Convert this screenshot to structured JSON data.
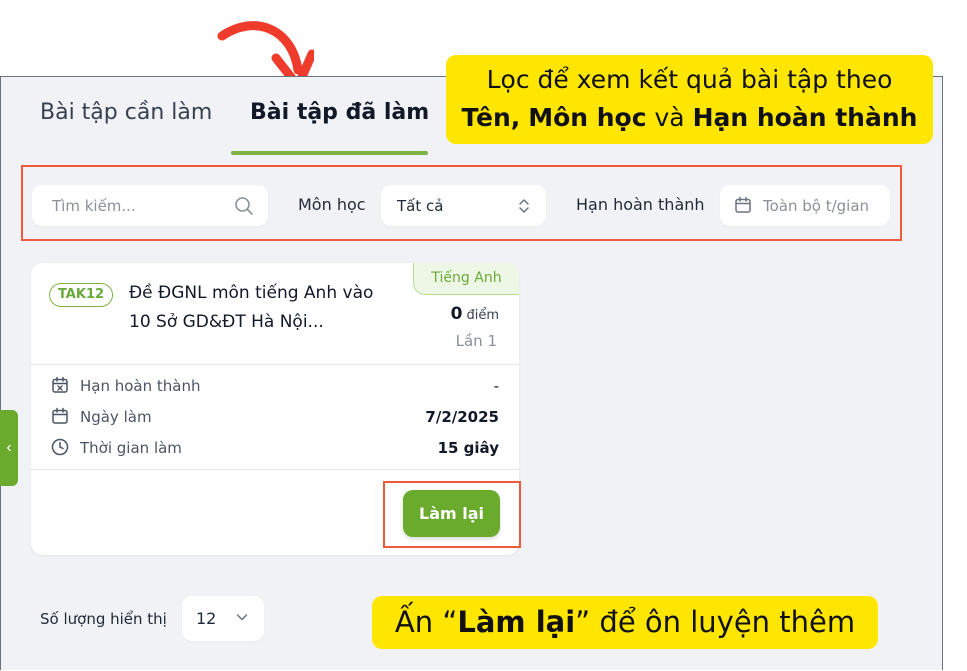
{
  "tabs": {
    "todo": "Bài tập cần làm",
    "done": "Bài tập đã làm"
  },
  "callout_top": {
    "line1": "Lọc để xem kết quả bài tập theo",
    "name": "Tên,",
    "subject": "Môn học",
    "and": "và",
    "deadline": "Hạn hoàn thành"
  },
  "callout_bottom": {
    "prefix": "Ấn “",
    "action": "Làm lại",
    "suffix": "” để ôn luyện thêm"
  },
  "filters": {
    "search_placeholder": "Tìm kiếm...",
    "subject_label": "Môn học",
    "subject_value": "Tất cả",
    "deadline_label": "Hạn hoàn thành",
    "deadline_placeholder": "Toàn bộ t/gian"
  },
  "card": {
    "subject_tag": "Tiếng Anh",
    "code": "TAK12",
    "title": "Đề ĐGNL môn tiếng Anh vào 10 Sở GD&ĐT Hà Nội...",
    "score": "0",
    "score_unit": "điểm",
    "attempt": "Lần 1",
    "rows": [
      {
        "label": "Hạn hoàn thành",
        "value": "-",
        "icon": "calendar-x-icon"
      },
      {
        "label": "Ngày làm",
        "value": "7/2/2025",
        "icon": "calendar-icon"
      },
      {
        "label": "Thời gian làm",
        "value": "15 giây",
        "icon": "clock-icon"
      }
    ],
    "redo_label": "Làm lại"
  },
  "side_handle": "‹",
  "pagination": {
    "label": "Số lượng hiển thị",
    "value": "12"
  },
  "colors": {
    "accent": "#6aaa2d",
    "highlight": "#ffe600",
    "annotation": "#ef5a3c"
  }
}
